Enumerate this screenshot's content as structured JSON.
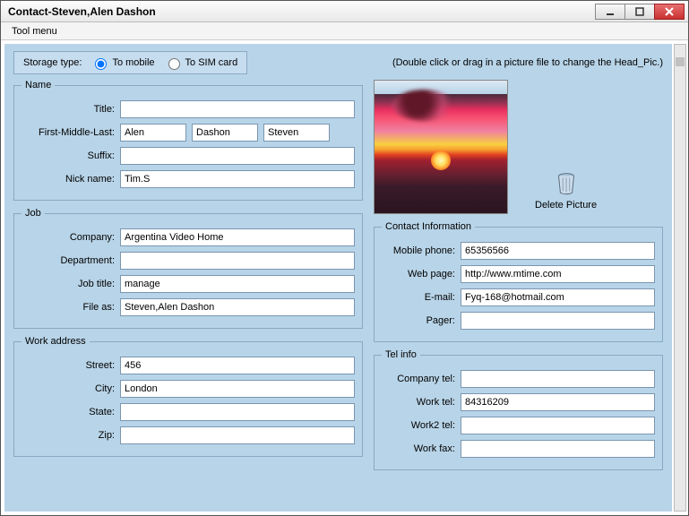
{
  "window": {
    "title": "Contact-Steven,Alen Dashon"
  },
  "menu": {
    "tool": "Tool menu"
  },
  "storage": {
    "label": "Storage type:",
    "to_mobile": "To mobile",
    "to_sim": "To SIM card",
    "selected": "mobile"
  },
  "hint": "(Double click or drag in a picture file to change the Head_Pic.)",
  "name_group": {
    "legend": "Name",
    "title_lbl": "Title:",
    "title": "",
    "fml_lbl": "First-Middle-Last:",
    "first": "Alen",
    "middle": "Dashon",
    "last": "Steven",
    "suffix_lbl": "Suffix:",
    "suffix": "",
    "nick_lbl": "Nick name:",
    "nick": "Tim.S"
  },
  "job_group": {
    "legend": "Job",
    "company_lbl": "Company:",
    "company": "Argentina Video Home",
    "dept_lbl": "Department:",
    "dept": "",
    "jobtitle_lbl": "Job title:",
    "jobtitle": "manage",
    "fileas_lbl": "File as:",
    "fileas": "Steven,Alen Dashon"
  },
  "work_addr_group": {
    "legend": "Work address",
    "street_lbl": "Street:",
    "street": "456",
    "city_lbl": "City:",
    "city": "London",
    "state_lbl": "State:",
    "state": "",
    "zip_lbl": "Zip:",
    "zip": ""
  },
  "delete_pic_label": "Delete Picture",
  "contact_group": {
    "legend": "Contact Information",
    "mobile_lbl": "Mobile phone:",
    "mobile": "65356566",
    "web_lbl": "Web page:",
    "web": "http://www.mtime.com",
    "email_lbl": "E-mail:",
    "email": "Fyq-168@hotmail.com",
    "pager_lbl": "Pager:",
    "pager": ""
  },
  "tel_group": {
    "legend": "Tel info",
    "company_tel_lbl": "Company tel:",
    "company_tel": "",
    "work_tel_lbl": "Work tel:",
    "work_tel": "84316209",
    "work2_tel_lbl": "Work2 tel:",
    "work2_tel": "",
    "work_fax_lbl": "Work fax:",
    "work_fax": ""
  }
}
